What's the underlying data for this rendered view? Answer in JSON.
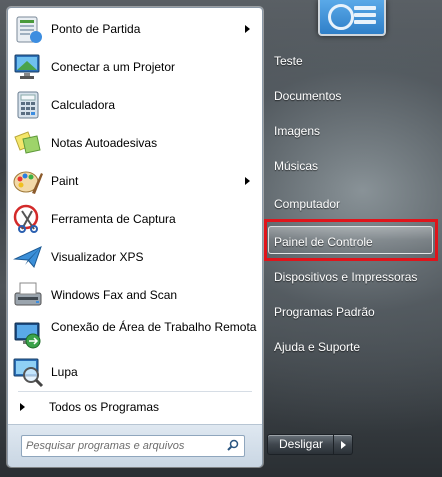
{
  "programs": [
    {
      "label": "Ponto de Partida",
      "icon": "getting-started-icon",
      "has_submenu": true
    },
    {
      "label": "Conectar a um Projetor",
      "icon": "projector-icon",
      "has_submenu": false
    },
    {
      "label": "Calculadora",
      "icon": "calculator-icon",
      "has_submenu": false
    },
    {
      "label": "Notas Autoadesivas",
      "icon": "sticky-notes-icon",
      "has_submenu": false
    },
    {
      "label": "Paint",
      "icon": "paint-icon",
      "has_submenu": true
    },
    {
      "label": "Ferramenta de Captura",
      "icon": "snipping-tool-icon",
      "has_submenu": false
    },
    {
      "label": "Visualizador XPS",
      "icon": "xps-viewer-icon",
      "has_submenu": false
    },
    {
      "label": "Windows Fax and Scan",
      "icon": "fax-scan-icon",
      "has_submenu": false
    },
    {
      "label": "Conexão de Área de Trabalho Remota",
      "icon": "remote-desktop-icon",
      "has_submenu": false
    },
    {
      "label": "Lupa",
      "icon": "magnifier-icon",
      "has_submenu": false
    }
  ],
  "all_programs_label": "Todos os Programas",
  "search": {
    "placeholder": "Pesquisar programas e arquivos"
  },
  "right_items": [
    {
      "label": "Teste"
    },
    {
      "label": "Documentos"
    },
    {
      "label": "Imagens"
    },
    {
      "label": "Músicas"
    },
    {
      "label": "Computador"
    },
    {
      "label": "Painel de Controle",
      "highlighted": true
    },
    {
      "label": "Dispositivos e Impressoras"
    },
    {
      "label": "Programas Padrão"
    },
    {
      "label": "Ajuda e Suporte"
    }
  ],
  "shutdown": {
    "label": "Desligar"
  },
  "colors": {
    "highlight_border": "#e0141b",
    "left_pane": "#ffffff",
    "right_text": "#ffffff"
  }
}
